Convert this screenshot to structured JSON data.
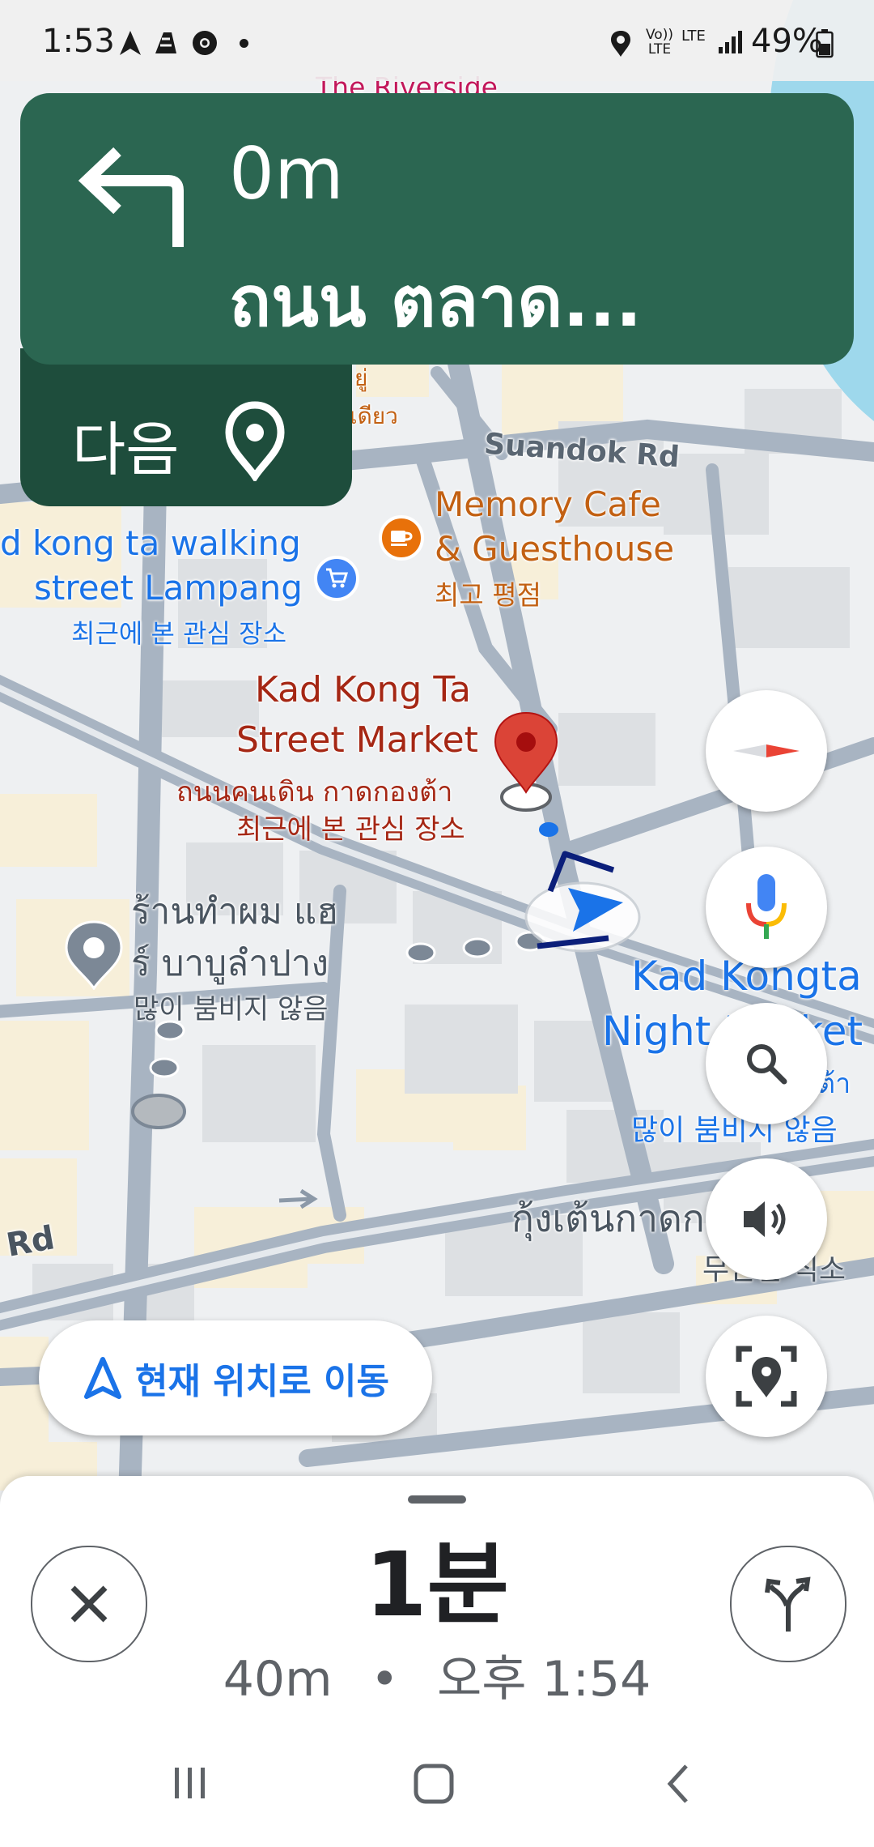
{
  "status_bar": {
    "time": "1:53",
    "battery": "49%",
    "network_top": "Vo))",
    "network_bottom": "LTE",
    "lte": "LTE"
  },
  "nav": {
    "distance": "0m",
    "street": "ถนน ตลาด...",
    "next_label": "다음"
  },
  "map": {
    "labels": {
      "riverside": "The Riverside",
      "suandok": "Suandok Rd",
      "memory_cafe_1": "Memory Cafe",
      "memory_cafe_2": "& Guesthouse",
      "memory_cafe_rating": "최고 평점",
      "walking_street_1": "d kong ta walking",
      "walking_street_2": "street Lampang",
      "walking_street_recent": "최근에 본 관심 장소",
      "market_1": "Kad Kong Ta",
      "market_2": "Street Market",
      "market_thai": "ถนนคนเดิน กาดกองต้า",
      "market_recent": "최근에 본 관심 장소",
      "barber_1": "ร้านทำผม แฮ",
      "barber_2": "ร์ บาบูลำปาง",
      "barber_busy": "많이 붐비지 않음",
      "night_1": "Kad Kongta",
      "night_2": "Night Market",
      "night_thai": "ต้า",
      "night_busy": "많이 붐비지 않음",
      "shrimp": "กุ้งเต้นกาดกองต้า",
      "shrimp_sub": "무난한 식소",
      "road_rd": "Rd",
      "partial_top": "เดียว",
      "partial_top2": "ยู่"
    }
  },
  "buttons": {
    "recenter_label": "현재 위치로 이동"
  },
  "trip": {
    "eta_minutes": "1분",
    "distance": "40m",
    "separator": "•",
    "arrival": "오후 1:54"
  },
  "colors": {
    "nav_green": "#2b6651",
    "next_green": "#1e4d3c",
    "route_blue": "#1a73e8",
    "pin_red": "#db4437",
    "poi_orange": "#c26012",
    "poi_red": "#a52714"
  }
}
